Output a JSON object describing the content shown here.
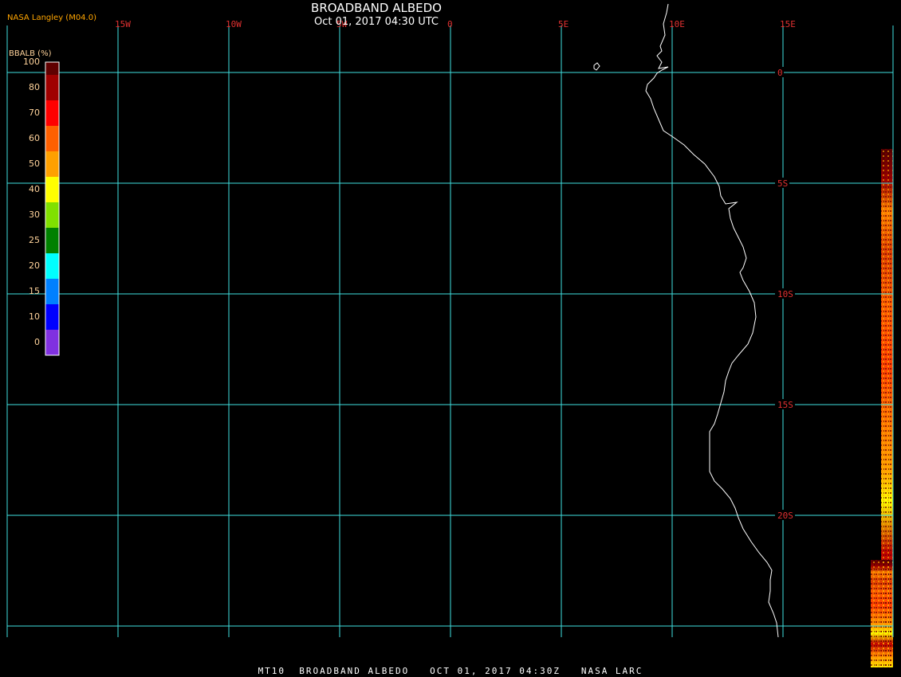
{
  "header": {
    "title": "BROADBAND ALBEDO",
    "datetime": "Oct 01, 2017 04:30 UTC",
    "credit": "NASA Langley (M04.0)"
  },
  "footer": {
    "caption": "MT10  BROADBAND ALBEDO   OCT 01, 2017 04:30Z   NASA LARC"
  },
  "map": {
    "background_color": "#000000",
    "grid_color": "#40e0e0",
    "label_color": "#e03030",
    "coastline_color": "#ffffff",
    "longitude_labels": [
      "15W",
      "10W",
      "5W",
      "0",
      "5E",
      "10E",
      "15E"
    ],
    "latitude_labels": [
      "0",
      "5S",
      "10S",
      "15S",
      "20S"
    ]
  },
  "colorbar": {
    "title": "BBALB (%)",
    "ticks": [
      "100",
      "80",
      "70",
      "60",
      "50",
      "40",
      "30",
      "25",
      "20",
      "15",
      "10",
      "0"
    ],
    "colors": [
      "#600000",
      "#a00000",
      "#ff0000",
      "#ff6000",
      "#ffa000",
      "#ffff00",
      "#80e000",
      "#008000",
      "#00ffff",
      "#0080ff",
      "#0000ff",
      "#8030e0"
    ]
  }
}
